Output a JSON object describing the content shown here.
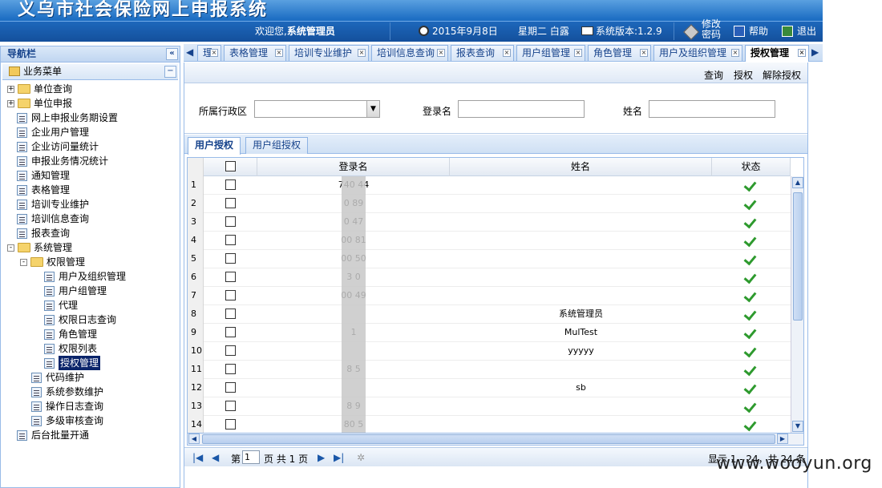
{
  "header": {
    "title": "义乌市社会保险网上申报系统",
    "welcome": "欢迎您,",
    "user": "系统管理员",
    "date": "2015年9月8日",
    "weekday": "星期二 白露",
    "version": "系统版本:1.2.9",
    "change_password": "修改密码",
    "help": "帮助",
    "logout": "退出"
  },
  "nav": {
    "title": "导航栏",
    "menu_title": "业务菜单",
    "items": [
      {
        "label": "单位查询",
        "type": "folder",
        "level": 0,
        "expand": "+"
      },
      {
        "label": "单位申报",
        "type": "folder",
        "level": 0,
        "expand": "+"
      },
      {
        "label": "网上申报业务期设置",
        "type": "leaf",
        "level": 0
      },
      {
        "label": "企业用户管理",
        "type": "leaf",
        "level": 0
      },
      {
        "label": "企业访问量统计",
        "type": "leaf",
        "level": 0
      },
      {
        "label": "申报业务情况统计",
        "type": "leaf",
        "level": 0
      },
      {
        "label": "通知管理",
        "type": "leaf",
        "level": 0
      },
      {
        "label": "表格管理",
        "type": "leaf",
        "level": 0
      },
      {
        "label": "培训专业维护",
        "type": "leaf",
        "level": 0
      },
      {
        "label": "培训信息查询",
        "type": "leaf",
        "level": 0
      },
      {
        "label": "报表查询",
        "type": "leaf",
        "level": 0
      },
      {
        "label": "系统管理",
        "type": "folder",
        "level": 0,
        "expand": "-"
      },
      {
        "label": "权限管理",
        "type": "folder",
        "level": 1,
        "expand": "-"
      },
      {
        "label": "用户及组织管理",
        "type": "leaf",
        "level": 2
      },
      {
        "label": "用户组管理",
        "type": "leaf",
        "level": 2
      },
      {
        "label": "代理",
        "type": "leaf",
        "level": 2
      },
      {
        "label": "权限日志查询",
        "type": "leaf",
        "level": 2
      },
      {
        "label": "角色管理",
        "type": "leaf",
        "level": 2
      },
      {
        "label": "权限列表",
        "type": "leaf",
        "level": 2
      },
      {
        "label": "授权管理",
        "type": "leaf",
        "level": 2,
        "selected": true
      },
      {
        "label": "代码维护",
        "type": "leaf",
        "level": 1
      },
      {
        "label": "系统参数维护",
        "type": "leaf",
        "level": 1
      },
      {
        "label": "操作日志查询",
        "type": "leaf",
        "level": 1
      },
      {
        "label": "多级审核查询",
        "type": "leaf",
        "level": 1
      },
      {
        "label": "后台批量开通",
        "type": "leaf",
        "level": 0
      }
    ]
  },
  "tabs": [
    "理",
    "表格管理",
    "培训专业维护",
    "培训信息查询",
    "报表查询",
    "用户组管理",
    "角色管理",
    "用户及组织管理",
    "授权管理"
  ],
  "toolbar": {
    "query": "查询",
    "grant": "授权",
    "revoke": "解除授权"
  },
  "form": {
    "region_label": "所属行政区",
    "login_label": "登录名",
    "name_label": "姓名"
  },
  "subtabs": [
    "用户授权",
    "用户组授权"
  ],
  "grid": {
    "headers": [
      "登录名",
      "姓名",
      "状态"
    ],
    "rows": [
      {
        "n": "1",
        "login": "740  44",
        "name": ""
      },
      {
        "n": "2",
        "login": "0    89",
        "name": ""
      },
      {
        "n": "3",
        "login": "0    47",
        "name": ""
      },
      {
        "n": "4",
        "login": "00   81",
        "name": ""
      },
      {
        "n": "5",
        "login": "00   50",
        "name": ""
      },
      {
        "n": "6",
        "login": "3    0",
        "name": ""
      },
      {
        "n": "7",
        "login": "00   49",
        "name": ""
      },
      {
        "n": "8",
        "login": "",
        "name": "系统管理员"
      },
      {
        "n": "9",
        "login": "   1",
        "name": "MulTest"
      },
      {
        "n": "10",
        "login": "",
        "name": "yyyyy"
      },
      {
        "n": "11",
        "login": "8   5",
        "name": ""
      },
      {
        "n": "12",
        "login": "",
        "name": "sb"
      },
      {
        "n": "13",
        "login": "8   9",
        "name": ""
      },
      {
        "n": "14",
        "login": "80  5",
        "name": ""
      }
    ]
  },
  "pager": {
    "page_prefix": "第",
    "page": "1",
    "page_suffix": "页 共 1 页",
    "display": "显示 1 - 24，共 24 条"
  },
  "watermark": "www.wooyun.org"
}
